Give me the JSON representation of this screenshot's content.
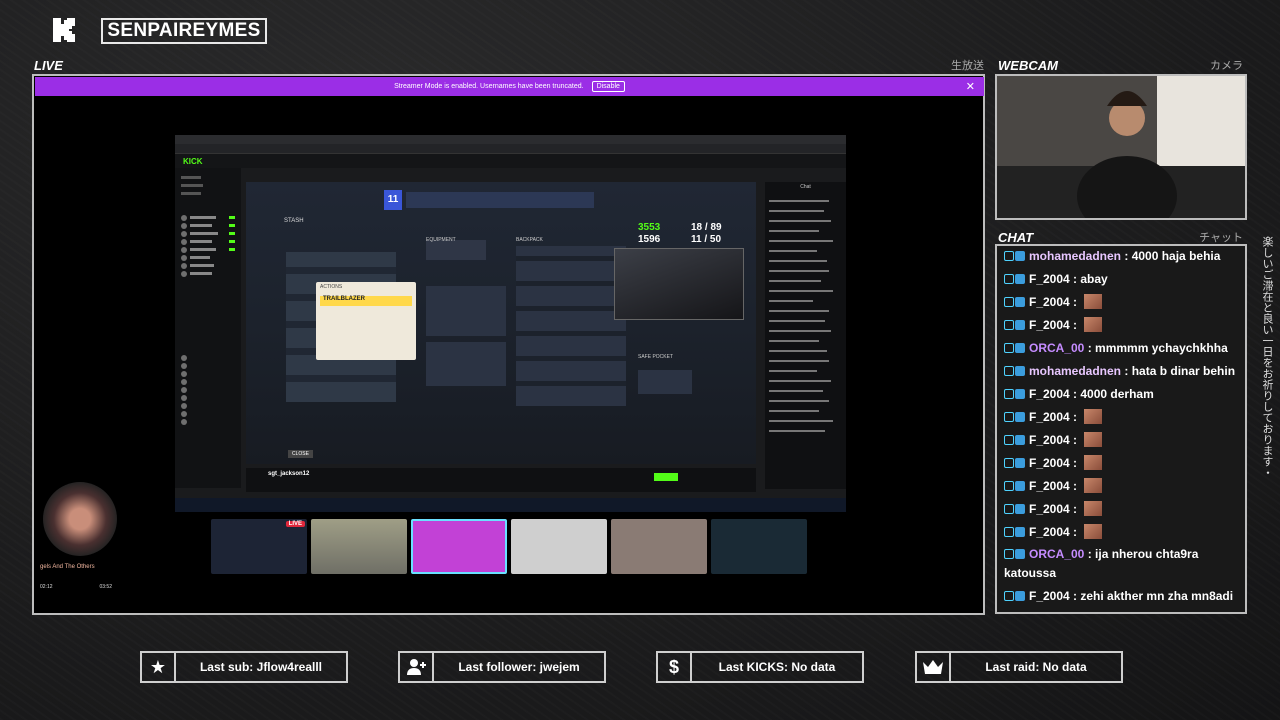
{
  "header": {
    "channel_name": "SENPAIREYMES"
  },
  "live_panel": {
    "title": "LIVE",
    "title_jp": "生放送"
  },
  "webcam_panel": {
    "title": "WEBCAM",
    "title_jp": "カメラ"
  },
  "chat_panel": {
    "title": "CHAT",
    "title_jp": "チャット",
    "messages": [
      {
        "user": "mohamedadnen",
        "text": "4000 haja behia",
        "color": "#e8c7ff"
      },
      {
        "user": "F_2004",
        "text": "abay",
        "color": "#ffffff"
      },
      {
        "user": "F_2004",
        "text": "",
        "color": "#ffffff",
        "emote": "emote"
      },
      {
        "user": "F_2004",
        "text": "",
        "color": "#ffffff",
        "emote": "emote"
      },
      {
        "user": "ORCA_00",
        "text": "mmmmm ychaychkhha",
        "color": "#c58cff"
      },
      {
        "user": "mohamedadnen",
        "text": "hata b dinar behin",
        "color": "#e8c7ff"
      },
      {
        "user": "F_2004",
        "text": "4000 derham",
        "color": "#ffffff"
      },
      {
        "user": "F_2004",
        "text": "",
        "color": "#ffffff",
        "emote": "emote"
      },
      {
        "user": "F_2004",
        "text": "",
        "color": "#ffffff",
        "emote": "emote"
      },
      {
        "user": "F_2004",
        "text": "",
        "color": "#ffffff",
        "emote": "emote"
      },
      {
        "user": "F_2004",
        "text": "",
        "color": "#ffffff",
        "emote": "emote"
      },
      {
        "user": "F_2004",
        "text": "",
        "color": "#ffffff",
        "emote": "emote"
      },
      {
        "user": "F_2004",
        "text": "",
        "color": "#ffffff",
        "emote": "emote"
      },
      {
        "user": "ORCA_00",
        "text": "ija nherou chta9ra katoussa",
        "color": "#c58cff"
      },
      {
        "user": "F_2004",
        "text": "zehi akther mn zha mn8adi",
        "color": "#ffffff"
      }
    ]
  },
  "side_text": "楽しいご滞在と良い一日をお祈りしております・",
  "streamer_mode": {
    "message": "Streamer Mode is enabled. Usernames have been truncated.",
    "disable_label": "Disable"
  },
  "stream_screen": {
    "site_logo": "KICK",
    "game": {
      "stash_label": "STASH",
      "item_name": "TRAILBLAZER",
      "tooltip_header": "ACTIONS",
      "equipment_label": "EQUIPMENT",
      "backpack_label": "BACKPACK",
      "safe_pocket_label": "SAFE POCKET",
      "close_label": "CLOSE",
      "hud_top": "11",
      "hud_score": "3553",
      "hud_stat1": "1596",
      "hud_stat2": "18 / 89",
      "hud_stat3": "11 / 50"
    },
    "stream_title": "sgt_jackson12",
    "chat_label": "Chat"
  },
  "taskbar_live_label": "LIVE",
  "mini_player": {
    "track": "gels And The Others",
    "time_elapsed": "02:12",
    "time_total": "03:52"
  },
  "stats": {
    "last_sub": "Last sub: Jflow4realll",
    "last_follower": "Last follower: jwejem",
    "last_kicks": "Last KICKS: No data",
    "last_raid": "Last raid: No data"
  },
  "colors": {
    "accent_purple": "#9b2ee6",
    "kick_green": "#53fc18",
    "frame": "#bdbdbd"
  },
  "icons": [
    "kick-logo-icon",
    "star-icon",
    "add-user-icon",
    "dollar-icon",
    "crown-icon",
    "close-icon"
  ]
}
